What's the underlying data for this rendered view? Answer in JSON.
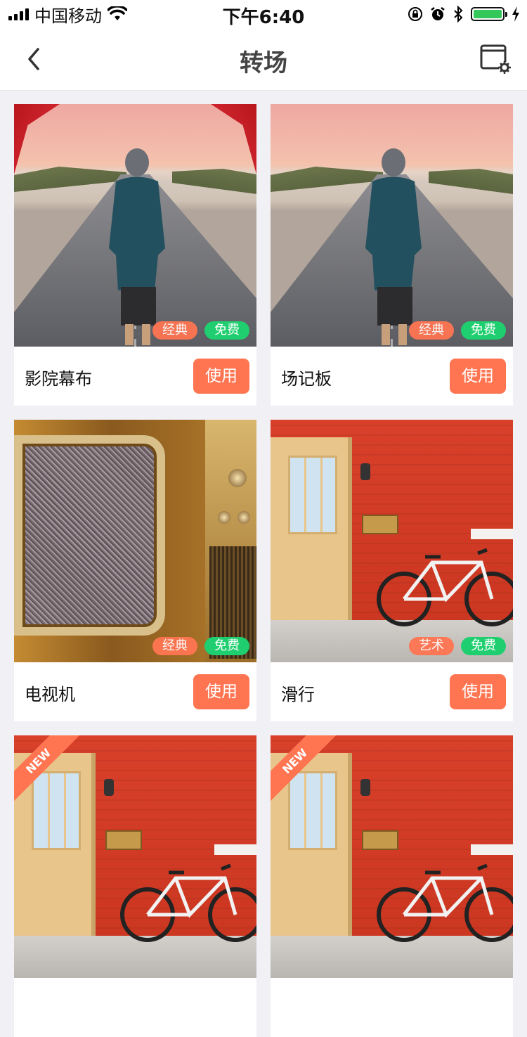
{
  "status_bar": {
    "carrier": "中国移动",
    "time": "下午6:40",
    "icons": [
      "signal-icon",
      "wifi-icon",
      "rotation-lock-icon",
      "alarm-icon",
      "bluetooth-icon",
      "battery-icon",
      "charging-icon"
    ],
    "battery_color": "#34c759"
  },
  "nav": {
    "title": "转场",
    "back_icon": "chevron-left-icon",
    "settings_icon": "window-settings-icon"
  },
  "colors": {
    "accent": "#ff7552",
    "free_tag": "#1fcf6f",
    "background": "#f0f0f5"
  },
  "cards": [
    {
      "name": "影院幕布",
      "button": "使用",
      "tags": [
        "经典",
        "免费"
      ],
      "scene": "road-with-curtains"
    },
    {
      "name": "场记板",
      "button": "使用",
      "tags": [
        "经典",
        "免费"
      ],
      "scene": "road"
    },
    {
      "name": "电视机",
      "button": "使用",
      "tags": [
        "经典",
        "免费"
      ],
      "scene": "retro-tv"
    },
    {
      "name": "滑行",
      "button": "使用",
      "tags": [
        "艺术",
        "免费"
      ],
      "scene": "brick-wall-bike"
    },
    {
      "ribbon": "NEW",
      "scene": "brick-wall-bike"
    },
    {
      "ribbon": "NEW",
      "scene": "brick-wall-bike"
    }
  ]
}
